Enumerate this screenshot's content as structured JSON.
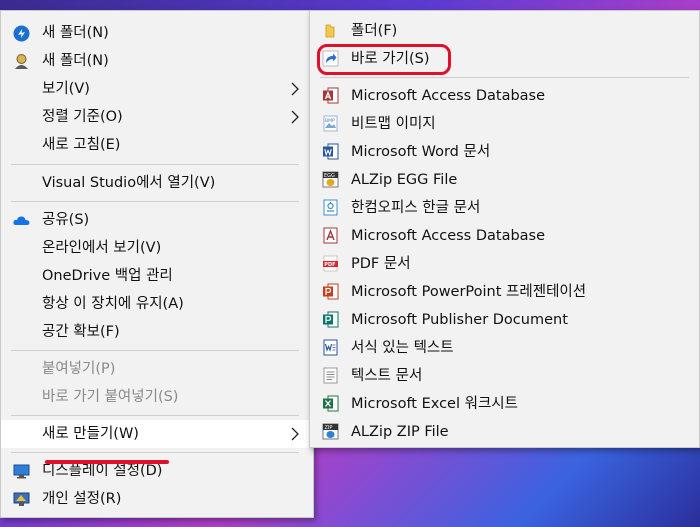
{
  "main_menu": {
    "items": [
      {
        "label": "새 폴더(N)",
        "icon": "blue-arrow-icon"
      },
      {
        "label": "새 폴더(N)",
        "icon": "user-badge-icon"
      },
      {
        "label": "보기(V)"
      },
      {
        "label": "정렬 기준(O)"
      },
      {
        "label": "새로 고침(E)"
      },
      {
        "label": "Visual Studio에서 열기(V)"
      },
      {
        "label": "공유(S)",
        "icon": "onedrive-cloud-icon"
      },
      {
        "label": "온라인에서 보기(V)"
      },
      {
        "label": "OneDrive 백업 관리"
      },
      {
        "label": "항상 이 장치에 유지(A)"
      },
      {
        "label": "공간 확보(F)"
      },
      {
        "label": "붙여넣기(P)"
      },
      {
        "label": "바로 가기 붙여넣기(S)"
      },
      {
        "label": "새로 만들기(W)"
      },
      {
        "label": "디스플레이 설정(D)",
        "icon": "display-icon"
      },
      {
        "label": "개인 설정(R)",
        "icon": "personalize-icon"
      }
    ]
  },
  "sub_menu": {
    "items": [
      {
        "label": "폴더(F)",
        "icon": "folder-icon"
      },
      {
        "label": "바로 가기(S)",
        "icon": "shortcut-icon"
      },
      {
        "label": "Microsoft Access Database",
        "icon": "access-icon"
      },
      {
        "label": "비트맵 이미지",
        "icon": "bitmap-icon"
      },
      {
        "label": "Microsoft Word 문서",
        "icon": "word-icon"
      },
      {
        "label": "ALZip EGG File",
        "icon": "alzip-egg-icon"
      },
      {
        "label": "한컴오피스 한글 문서",
        "icon": "hwp-icon"
      },
      {
        "label": "Microsoft Access Database",
        "icon": "access-icon"
      },
      {
        "label": "PDF 문서",
        "icon": "pdf-icon"
      },
      {
        "label": "Microsoft PowerPoint 프레젠테이션",
        "icon": "powerpoint-icon"
      },
      {
        "label": "Microsoft Publisher Document",
        "icon": "publisher-icon"
      },
      {
        "label": "서식 있는 텍스트",
        "icon": "rtf-icon"
      },
      {
        "label": "텍스트 문서",
        "icon": "text-document-icon"
      },
      {
        "label": "Microsoft Excel 워크시트",
        "icon": "excel-icon"
      },
      {
        "label": "ALZip ZIP File",
        "icon": "alzip-zip-icon"
      }
    ]
  },
  "icon_labels": {
    "bmp": "BMP",
    "egg": "EGG",
    "pdf": "PDF",
    "zip": "ZIP"
  },
  "colors": {
    "annotation": "#e0102a",
    "menu_bg": "#f2f2f2",
    "hover_bg": "#ffffff"
  }
}
